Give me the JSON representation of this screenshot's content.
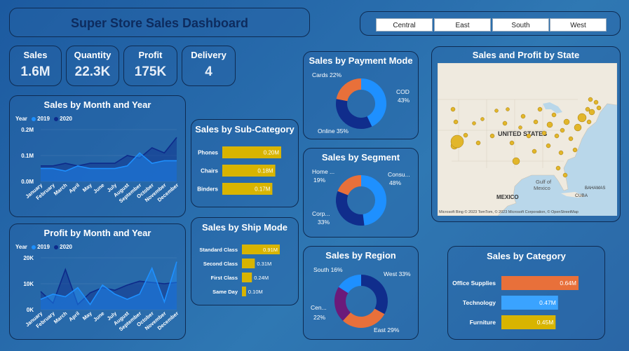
{
  "title": "Super Store Sales Dashboard",
  "regions": [
    "Central",
    "East",
    "South",
    "West"
  ],
  "kpis": [
    {
      "label": "Sales",
      "value": "1.6M"
    },
    {
      "label": "Quantity",
      "value": "22.3K"
    },
    {
      "label": "Profit",
      "value": "175K"
    },
    {
      "label": "Delivery",
      "value": "4"
    }
  ],
  "colors": {
    "y2019": "#1e90ff",
    "y2020": "#0d2a8a",
    "bar_yellow": "#d8b400",
    "bar_orange": "#e8703a",
    "bar_blue": "#3aa3ff",
    "donut_orange": "#e8703a",
    "donut_light": "#1e90ff",
    "donut_dark": "#102d8c",
    "donut_purple": "#6b1a7a"
  },
  "sales_month": {
    "title": "Sales by Month and Year",
    "legend": {
      "label": "Year",
      "s1": "2019",
      "s2": "2020"
    },
    "months": [
      "January",
      "February",
      "March",
      "April",
      "May",
      "June",
      "July",
      "August",
      "September",
      "October",
      "November",
      "December"
    ],
    "ticks": [
      "0.0M",
      "0.1M",
      "0.2M"
    ]
  },
  "profit_month": {
    "title": "Profit by Month and Year",
    "legend": {
      "label": "Year",
      "s1": "2019",
      "s2": "2020"
    },
    "months": [
      "January",
      "February",
      "March",
      "April",
      "May",
      "June",
      "July",
      "August",
      "September",
      "October",
      "November",
      "December"
    ],
    "ticks": [
      "0K",
      "10K",
      "20K"
    ]
  },
  "subcategory": {
    "title": "Sales by Sub-Category"
  },
  "shipmode": {
    "title": "Sales by Ship Mode"
  },
  "payment": {
    "title": "Sales by Payment Mode",
    "labels": [
      "Cards 22%",
      "COD",
      "43%",
      "Online 35%"
    ]
  },
  "segment": {
    "title": "Sales by Segment",
    "labels": [
      "Home ...",
      "19%",
      "Consu...",
      "48%",
      "Corp...",
      "33%"
    ]
  },
  "region_donut": {
    "title": "Sales by Region",
    "labels": [
      "South 16%",
      "West 33%",
      "Cen...",
      "22%",
      "East 29%"
    ]
  },
  "category": {
    "title": "Sales by Category"
  },
  "map": {
    "title": "Sales and Profit by State",
    "country_label": "UNITED STATES",
    "mexico_label": "MEXICO",
    "gulf_label1": "Gulf of",
    "gulf_label2": "Mexico",
    "cuba_label": "CUBA",
    "bahamas_label": "BAHAMAS",
    "attribution": "Microsoft Bing  © 2023 TomTom, © 2023 Microsoft Corporation, © OpenStreetMap"
  },
  "chart_data": [
    {
      "type": "area",
      "title": "Sales by Month and Year",
      "categories": [
        "January",
        "February",
        "March",
        "April",
        "May",
        "June",
        "July",
        "August",
        "September",
        "October",
        "November",
        "December"
      ],
      "ylim": [
        0,
        0.2
      ],
      "series": [
        {
          "name": "2019",
          "values": [
            0.05,
            0.05,
            0.04,
            0.06,
            0.05,
            0.05,
            0.05,
            0.06,
            0.11,
            0.07,
            0.08,
            0.08
          ]
        },
        {
          "name": "2020",
          "values": [
            0.06,
            0.06,
            0.07,
            0.06,
            0.07,
            0.07,
            0.07,
            0.1,
            0.09,
            0.13,
            0.11,
            0.17
          ]
        }
      ]
    },
    {
      "type": "area",
      "title": "Profit by Month and Year",
      "categories": [
        "January",
        "February",
        "March",
        "April",
        "May",
        "June",
        "July",
        "August",
        "September",
        "October",
        "November",
        "December"
      ],
      "ylim": [
        0,
        20
      ],
      "series": [
        {
          "name": "2019",
          "values": [
            4.0,
            6.0,
            5.0,
            8.5,
            2.0,
            9.5,
            6.0,
            4.0,
            6.0,
            16.0,
            3.0,
            18.5
          ]
        },
        {
          "name": "2020",
          "values": [
            7.0,
            2.5,
            15.5,
            2.0,
            6.5,
            8.5,
            7.5,
            9.5,
            11.0,
            10.5,
            10.0,
            10.5
          ]
        }
      ]
    },
    {
      "type": "bar",
      "title": "Sales by Sub-Category",
      "categories": [
        "Phones",
        "Chairs",
        "Binders"
      ],
      "values": [
        0.2,
        0.18,
        0.17
      ],
      "labels": [
        "0.20M",
        "0.18M",
        "0.17M"
      ]
    },
    {
      "type": "bar",
      "title": "Sales by Ship Mode",
      "categories": [
        "Standard Class",
        "Second Class",
        "First Class",
        "Same Day"
      ],
      "values": [
        0.91,
        0.31,
        0.24,
        0.1
      ],
      "labels": [
        "0.91M",
        "0.31M",
        "0.24M",
        "0.10M"
      ]
    },
    {
      "type": "pie",
      "title": "Sales by Payment Mode",
      "slices": [
        {
          "name": "COD",
          "value": 43
        },
        {
          "name": "Online",
          "value": 35
        },
        {
          "name": "Cards",
          "value": 22
        }
      ]
    },
    {
      "type": "pie",
      "title": "Sales by Segment",
      "slices": [
        {
          "name": "Consumer",
          "value": 48
        },
        {
          "name": "Corporate",
          "value": 33
        },
        {
          "name": "Home Office",
          "value": 19
        }
      ]
    },
    {
      "type": "pie",
      "title": "Sales by Region",
      "slices": [
        {
          "name": "West",
          "value": 33
        },
        {
          "name": "East",
          "value": 29
        },
        {
          "name": "Central",
          "value": 22
        },
        {
          "name": "South",
          "value": 16
        }
      ]
    },
    {
      "type": "bar",
      "title": "Sales by Category",
      "categories": [
        "Office Supplies",
        "Technology",
        "Furniture"
      ],
      "values": [
        0.64,
        0.47,
        0.45
      ],
      "labels": [
        "0.64M",
        "0.47M",
        "0.45M"
      ]
    }
  ]
}
